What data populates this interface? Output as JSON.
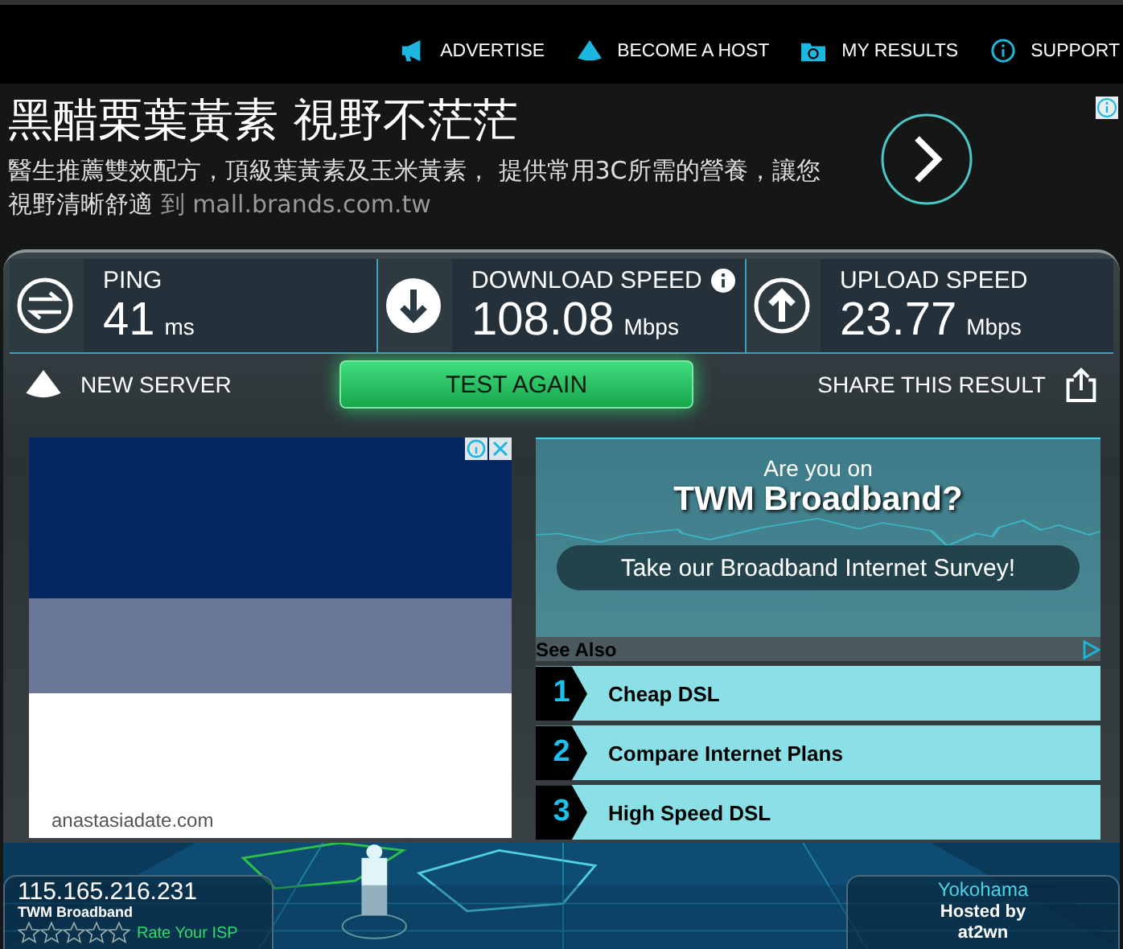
{
  "nav": [
    {
      "label": "ADVERTISE"
    },
    {
      "label": "BECOME A HOST"
    },
    {
      "label": "MY RESULTS"
    },
    {
      "label": "SUPPORT"
    }
  ],
  "ad_banner": {
    "title": "黑醋栗葉黃素 視野不茫茫",
    "text": "醫生推薦雙效配方，頂級葉黃素及玉米黃素， 提供常用3C所需的營養，讓您視野清晰舒適",
    "link_prefix": "到",
    "link": "mall.brands.com.tw"
  },
  "stats": [
    {
      "kind": "ping",
      "label": "PING",
      "value": "41",
      "unit": "ms",
      "info": false
    },
    {
      "kind": "download",
      "label": "DOWNLOAD SPEED",
      "value": "108.08",
      "unit": "Mbps",
      "info": true
    },
    {
      "kind": "upload",
      "label": "UPLOAD SPEED",
      "value": "23.77",
      "unit": "Mbps",
      "info": false
    }
  ],
  "actions": {
    "new_server": "NEW SERVER",
    "test_again": "TEST AGAIN",
    "share": "SHARE THIS RESULT"
  },
  "left_ad": {
    "domain": "anastasiadate.com"
  },
  "survey": {
    "line1": "Are you on",
    "line2": "TWM Broadband?",
    "button": "Take our Broadband Internet Survey!"
  },
  "see_also": {
    "heading": "See Also",
    "links": [
      {
        "number": "1",
        "label": "Cheap DSL"
      },
      {
        "number": "2",
        "label": "Compare Internet Plans"
      },
      {
        "number": "3",
        "label": "High Speed DSL"
      }
    ]
  },
  "isp": {
    "ip": "115.165.216.231",
    "name": "TWM Broadband",
    "stars": 0,
    "rate": "Rate Your ISP"
  },
  "server": {
    "city": "Yokohama",
    "hosted_by": "Hosted by",
    "host": "at2wn"
  }
}
